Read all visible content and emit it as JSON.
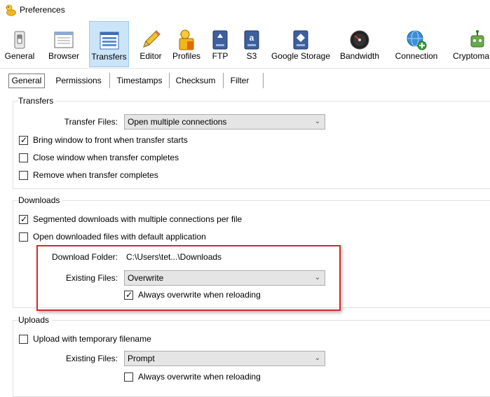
{
  "window": {
    "title": "Preferences"
  },
  "toolbar": {
    "items": [
      {
        "label": "General",
        "icon": "switch-icon"
      },
      {
        "label": "Browser",
        "icon": "browser-window-icon"
      },
      {
        "label": "Transfers",
        "icon": "transfers-list-icon"
      },
      {
        "label": "Editor",
        "icon": "pencil-icon"
      },
      {
        "label": "Profiles",
        "icon": "duck-profiles-icon"
      },
      {
        "label": "FTP",
        "icon": "ftp-drive-icon"
      },
      {
        "label": "S3",
        "icon": "amazon-s3-icon"
      },
      {
        "label": "Google Storage",
        "icon": "google-storage-icon"
      },
      {
        "label": "Bandwidth",
        "icon": "gauge-icon"
      },
      {
        "label": "Connection",
        "icon": "globe-plus-icon"
      },
      {
        "label": "Cryptoma",
        "icon": "robot-icon"
      }
    ],
    "selected": "Transfers"
  },
  "tabs": {
    "items": [
      "General",
      "Permissions",
      "Timestamps",
      "Checksum",
      "Filter"
    ],
    "selected": "General"
  },
  "transfers": {
    "title": "Transfers",
    "transfer_files_label": "Transfer Files:",
    "transfer_files_value": "Open multiple connections",
    "bring_to_front": "Bring window to front when transfer starts",
    "close_window": "Close window when transfer completes",
    "remove_when": "Remove when transfer completes"
  },
  "downloads": {
    "title": "Downloads",
    "segmented": "Segmented downloads with multiple connections per file",
    "open_default": "Open downloaded files with default application",
    "folder_label": "Download Folder:",
    "folder_value": "C:\\Users\\tet...\\Downloads",
    "existing_label": "Existing Files:",
    "existing_value": "Overwrite",
    "always_overwrite": "Always overwrite when reloading"
  },
  "uploads": {
    "title": "Uploads",
    "temp_filename": "Upload with temporary filename",
    "existing_label": "Existing Files:",
    "existing_value": "Prompt",
    "always_overwrite": "Always overwrite when reloading"
  },
  "checkbox_states": {
    "bring_to_front": true,
    "close_window": false,
    "remove_when": false,
    "segmented": true,
    "open_default": false,
    "downloads_always_overwrite": true,
    "temp_filename": false,
    "uploads_always_overwrite": false
  },
  "colors": {
    "selected_toolbar_bg": "#cce4f7",
    "highlight_border": "#d9262b"
  }
}
